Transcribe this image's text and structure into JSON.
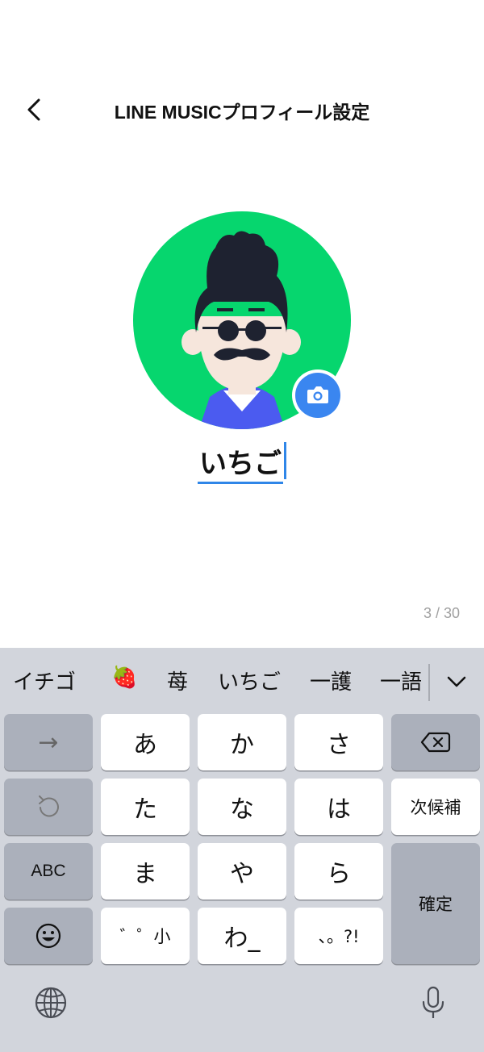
{
  "header": {
    "title": "LINE MUSICプロフィール設定"
  },
  "profile": {
    "name": "いちご",
    "counter": "3 / 30"
  },
  "candidates": [
    "イチゴ",
    "🍓",
    "苺",
    "いちご",
    "一護",
    "一語"
  ],
  "keyboard": {
    "rows": [
      [
        "→",
        "あ",
        "か",
        "さ",
        "⌫"
      ],
      [
        "↺",
        "た",
        "な",
        "は",
        "次候補"
      ],
      [
        "ABC",
        "ま",
        "や",
        "ら",
        "確定"
      ],
      [
        "☺",
        "゛゜小",
        "わ_",
        "、。?!"
      ]
    ],
    "labels": {
      "arrow": "→",
      "a": "あ",
      "ka": "か",
      "sa": "さ",
      "ta": "た",
      "na": "な",
      "ha": "は",
      "next": "次候補",
      "abc": "ABC",
      "ma": "ま",
      "ya": "や",
      "ra": "ら",
      "confirm": "確定",
      "dakuten": "゛゜小",
      "wa": "わ_",
      "punct": "、。?!"
    }
  },
  "colors": {
    "accent": "#2f86e8",
    "avatar_bg": "#06d66e",
    "camera": "#3a86f0",
    "keyboard_bg": "#d2d5dc"
  }
}
